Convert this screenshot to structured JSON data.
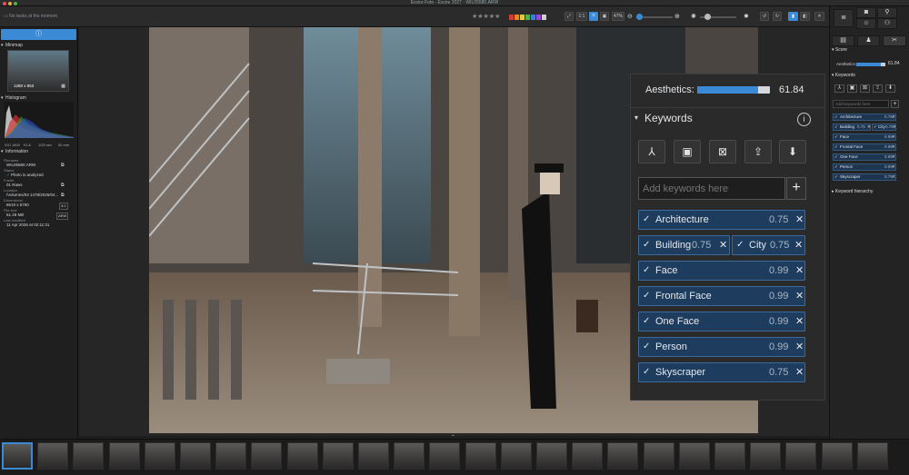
{
  "window": {
    "title": "Excire Foto - Excire 2027 - WIL05580.ARW"
  },
  "toolbar": {
    "tasks_text": "No tasks at the moment",
    "stars": "★★★★★",
    "view_1to1": "1:1",
    "zoom_pct": "47%",
    "colors": [
      "#d23a3a",
      "#e08a2c",
      "#e0c93a",
      "#4cb24a",
      "#3a7ed6",
      "#9a4ad0",
      "#cfcfcf"
    ]
  },
  "left": {
    "minimap_title": "Minimap",
    "minimap_size": "1280 x 853",
    "histogram_title": "Histogram",
    "hist_info": [
      "ISO 1600",
      "f/1.8",
      "1/25 sec",
      "50 mm"
    ],
    "information_title": "Information",
    "filename_label": "Filename",
    "filename": "WIL05580.ARW",
    "status_label": "Status",
    "status": "Photo is analyzed",
    "folder_label": "Folder",
    "folder": "01 Raws",
    "location_label": "Location",
    "location": "/Volumes/03 1478/2026/04...",
    "dimensions_label": "Dimensions",
    "dimensions": "8619 x 5760",
    "dim_badge": "3:2",
    "filesize_label": "File size",
    "filesize": "61.28 MB",
    "filesize_badge": "ARW",
    "modified_label": "Last modified",
    "modified": "11 Apr 2026 at 02:11:31"
  },
  "panel": {
    "aesthetics_label": "Aesthetics:",
    "aesthetics_value": "61.84",
    "aesthetics_fraction": 0.84,
    "keywords_title": "Keywords",
    "keywords_placeholder": "Add keywords here",
    "keywords": [
      {
        "label": "Architecture",
        "score": "0.75"
      },
      {
        "label": "Building",
        "score": "0.75"
      },
      {
        "label": "City",
        "score": "0.75"
      },
      {
        "label": "Face",
        "score": "0.99"
      },
      {
        "label": "Frontal Face",
        "score": "0.99"
      },
      {
        "label": "One Face",
        "score": "0.99"
      },
      {
        "label": "Person",
        "score": "0.99"
      },
      {
        "label": "Skyscraper",
        "score": "0.75"
      }
    ]
  },
  "right": {
    "score_title": "Score",
    "aesthetics_label": "Aesthetics:",
    "aesthetics_value": "61.84",
    "keywords_title": "Keywords",
    "placeholder": "Add keywords here",
    "hierarchy_title": "Keyword hierarchy",
    "keywords": [
      {
        "label": "Architecture",
        "score": "0.75"
      },
      {
        "label": "Building",
        "score": "0.75"
      },
      {
        "label": "City",
        "score": "0.75"
      },
      {
        "label": "Face",
        "score": "0.99"
      },
      {
        "label": "Frontal Face",
        "score": "0.99"
      },
      {
        "label": "One Face",
        "score": "0.99"
      },
      {
        "label": "Person",
        "score": "0.99"
      },
      {
        "label": "Skyscraper",
        "score": "0.75"
      }
    ]
  },
  "filmstrip": {
    "count": 25
  }
}
